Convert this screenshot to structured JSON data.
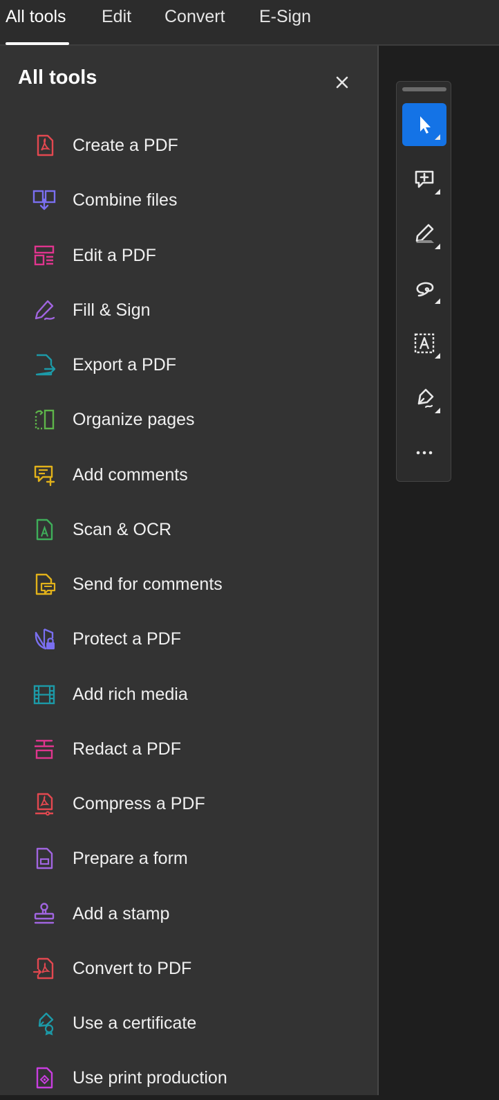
{
  "tabs": [
    {
      "label": "All tools",
      "active": true
    },
    {
      "label": "Edit",
      "active": false
    },
    {
      "label": "Convert",
      "active": false
    },
    {
      "label": "E-Sign",
      "active": false
    }
  ],
  "panel": {
    "title": "All tools",
    "close_icon": "close-icon",
    "tools": [
      {
        "label": "Create a PDF",
        "icon": "create-pdf-icon",
        "color": "#e34850"
      },
      {
        "label": "Combine files",
        "icon": "combine-files-icon",
        "color": "#7a6ff0"
      },
      {
        "label": "Edit a PDF",
        "icon": "edit-pdf-icon",
        "color": "#e0358e"
      },
      {
        "label": "Fill & Sign",
        "icon": "fill-sign-icon",
        "color": "#a165e0"
      },
      {
        "label": "Export a PDF",
        "icon": "export-pdf-icon",
        "color": "#1c9aa8"
      },
      {
        "label": "Organize pages",
        "icon": "organize-pages-icon",
        "color": "#5eb54a"
      },
      {
        "label": "Add comments",
        "icon": "add-comments-icon",
        "color": "#e2b21a"
      },
      {
        "label": "Scan & OCR",
        "icon": "scan-ocr-icon",
        "color": "#3fae5a"
      },
      {
        "label": "Send for comments",
        "icon": "send-for-comments-icon",
        "color": "#e2b21a"
      },
      {
        "label": "Protect a PDF",
        "icon": "protect-pdf-icon",
        "color": "#7a6ff0"
      },
      {
        "label": "Add rich media",
        "icon": "rich-media-icon",
        "color": "#1c9aa8"
      },
      {
        "label": "Redact a PDF",
        "icon": "redact-pdf-icon",
        "color": "#e0358e"
      },
      {
        "label": "Compress a PDF",
        "icon": "compress-pdf-icon",
        "color": "#e34850"
      },
      {
        "label": "Prepare a form",
        "icon": "prepare-form-icon",
        "color": "#a165e0"
      },
      {
        "label": "Add a stamp",
        "icon": "stamp-icon",
        "color": "#a165e0"
      },
      {
        "label": "Convert to PDF",
        "icon": "convert-to-pdf-icon",
        "color": "#e34850"
      },
      {
        "label": "Use a certificate",
        "icon": "certificate-icon",
        "color": "#1c9aa8"
      },
      {
        "label": "Use print production",
        "icon": "print-production-icon",
        "color": "#c93ee0"
      }
    ]
  },
  "quick_tools": [
    {
      "name": "select-tool",
      "icon": "cursor-icon",
      "active": true
    },
    {
      "name": "add-comment-tool",
      "icon": "comment-plus-icon",
      "active": false
    },
    {
      "name": "highlight-tool",
      "icon": "highlighter-icon",
      "active": false
    },
    {
      "name": "draw-tool",
      "icon": "freehand-icon",
      "active": false
    },
    {
      "name": "text-tool",
      "icon": "text-box-icon",
      "active": false
    },
    {
      "name": "sign-tool",
      "icon": "pen-nib-icon",
      "active": false
    },
    {
      "name": "more-tools",
      "icon": "more-icon",
      "active": false
    }
  ],
  "colors": {
    "accent": "#1473e6",
    "panel_bg": "#333333",
    "topbar_bg": "#2c2c2c"
  }
}
